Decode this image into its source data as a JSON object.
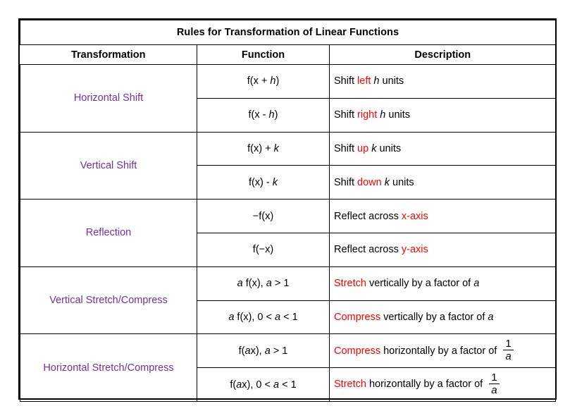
{
  "title": "Rules for Transformation of Linear Functions",
  "columns": {
    "transformation": "Transformation",
    "function": "Function",
    "description": "Description"
  },
  "colors": {
    "transformation_label": "#7030A0",
    "highlight": "#FF0000",
    "border": "#000000",
    "text": "#000000",
    "background": "#FFFFFF"
  },
  "groups": [
    {
      "label": "Horizontal Shift",
      "rows": [
        {
          "function_prefix": "f(x + ",
          "function_var": "h",
          "function_suffix": ")",
          "desc_prefix": "Shift ",
          "desc_keyword": "left",
          "desc_mid": " ",
          "desc_var": "h",
          "desc_suffix": " units",
          "fraction": null
        },
        {
          "function_prefix": "f(x  - ",
          "function_var": "h",
          "function_suffix": ")",
          "desc_prefix": "Shift ",
          "desc_keyword": "right",
          "desc_mid": " ",
          "desc_var": "h",
          "desc_suffix": " units",
          "fraction": null
        }
      ]
    },
    {
      "label": "Vertical Shift",
      "rows": [
        {
          "function_prefix": "f(x) + ",
          "function_var": "k",
          "function_suffix": "",
          "desc_prefix": "Shift ",
          "desc_keyword": "up",
          "desc_mid": " ",
          "desc_var": "k",
          "desc_suffix": " units",
          "fraction": null
        },
        {
          "function_prefix": "f(x) - ",
          "function_var": "k",
          "function_suffix": "",
          "desc_prefix": "Shift ",
          "desc_keyword": "down",
          "desc_mid": " ",
          "desc_var": "k",
          "desc_suffix": " units",
          "fraction": null
        }
      ]
    },
    {
      "label": "Reflection",
      "rows": [
        {
          "function_prefix": "−f(x)",
          "function_var": "",
          "function_suffix": "",
          "desc_prefix": "Reflect across ",
          "desc_keyword": "x-axis",
          "desc_mid": "",
          "desc_var": "",
          "desc_suffix": "",
          "fraction": null
        },
        {
          "function_prefix": "f(−x)",
          "function_var": "",
          "function_suffix": "",
          "desc_prefix": "Reflect across ",
          "desc_keyword": "y-axis",
          "desc_mid": "",
          "desc_var": "",
          "desc_suffix": "",
          "fraction": null
        }
      ]
    },
    {
      "label": "Vertical Stretch/Compress",
      "rows": [
        {
          "function_prefix": "",
          "function_var": "a",
          "function_suffix": " f(x), ",
          "function_var2": "a",
          "function_suffix2": " > 1",
          "desc_prefix": "",
          "desc_keyword": "Stretch",
          "desc_mid": " vertically by a factor of ",
          "desc_var": "a",
          "desc_suffix": "",
          "fraction": null
        },
        {
          "function_prefix": "",
          "function_var": "a",
          "function_suffix": " f(x), 0 < ",
          "function_var2": "a",
          "function_suffix2": " < 1",
          "desc_prefix": "",
          "desc_keyword": "Compress",
          "desc_mid": " vertically by a factor of ",
          "desc_var": "a",
          "desc_suffix": "",
          "fraction": null
        }
      ]
    },
    {
      "label": "Horizontal Stretch/Compress",
      "rows": [
        {
          "function_prefix": "f(",
          "function_var": "a",
          "function_suffix": "x), ",
          "function_var2": "a",
          "function_suffix2": " > 1",
          "desc_prefix": "",
          "desc_keyword": "Compress",
          "desc_mid": " horizontally by a factor of ",
          "desc_var": "",
          "desc_suffix": "",
          "fraction": {
            "numerator": "1",
            "denominator": "a"
          }
        },
        {
          "function_prefix": "f(",
          "function_var": "a",
          "function_suffix": "x), 0 < ",
          "function_var2": "a",
          "function_suffix2": " < 1",
          "desc_prefix": "",
          "desc_keyword": "Stretch",
          "desc_mid": " horizontally by a factor of ",
          "desc_var": "",
          "desc_suffix": "",
          "fraction": {
            "numerator": "1",
            "denominator": "a"
          }
        }
      ]
    }
  ]
}
